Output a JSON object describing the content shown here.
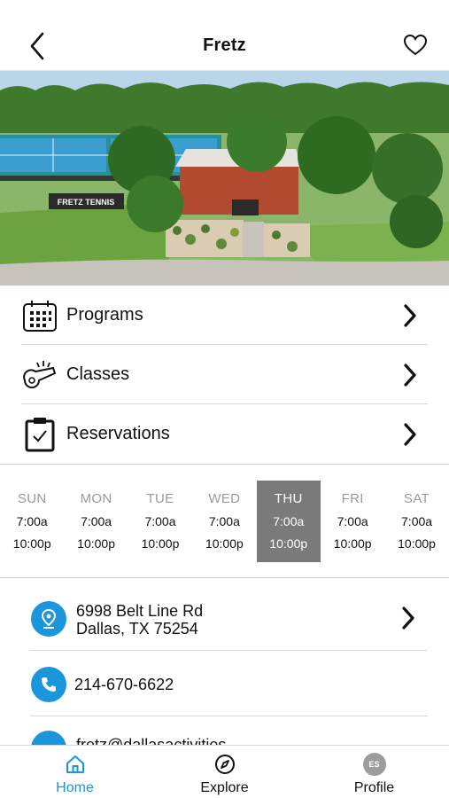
{
  "header": {
    "title": "Fretz",
    "back_icon": "chevron-left-icon",
    "favorite_icon": "heart-outline-icon"
  },
  "hero": {
    "sign_text": "FRETZ TENNIS"
  },
  "menu": {
    "items": [
      {
        "label": "Programs",
        "icon": "calendar-grid-icon"
      },
      {
        "label": "Classes",
        "icon": "whistle-icon"
      },
      {
        "label": "Reservations",
        "icon": "clipboard-check-icon"
      }
    ]
  },
  "hours": {
    "days": [
      {
        "name": "SUN",
        "open": "7:00a",
        "close": "10:00p",
        "active": false
      },
      {
        "name": "MON",
        "open": "7:00a",
        "close": "10:00p",
        "active": false
      },
      {
        "name": "TUE",
        "open": "7:00a",
        "close": "10:00p",
        "active": false
      },
      {
        "name": "WED",
        "open": "7:00a",
        "close": "10:00p",
        "active": false
      },
      {
        "name": "THU",
        "open": "7:00a",
        "close": "10:00p",
        "active": true
      },
      {
        "name": "FRI",
        "open": "7:00a",
        "close": "10:00p",
        "active": false
      },
      {
        "name": "SAT",
        "open": "7:00a",
        "close": "10:00p",
        "active": false
      }
    ]
  },
  "contact": {
    "address_line1": "6998 Belt Line Rd",
    "address_line2": "Dallas, TX 75254",
    "phone": "214-670-6622",
    "email_partial": "fretz@dallasactivities..."
  },
  "tabs": [
    {
      "label": "Home",
      "icon": "home-icon",
      "active": true
    },
    {
      "label": "Explore",
      "icon": "compass-icon",
      "active": false
    },
    {
      "label": "Profile",
      "icon": "avatar",
      "initials": "ES",
      "active": false
    }
  ],
  "colors": {
    "accent": "#1b96dc",
    "active_day_bg": "#7a7a7a",
    "inactive_day_text": "#9a9a9a"
  }
}
